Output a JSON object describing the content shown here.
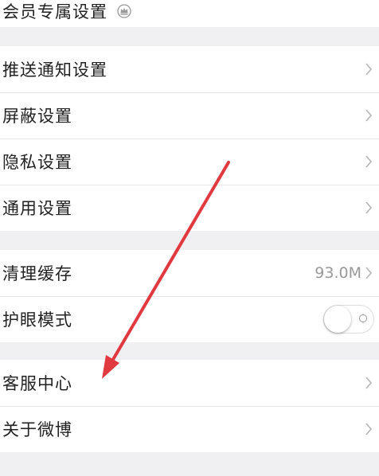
{
  "settings": {
    "vip": {
      "label": "会员专属设置",
      "icon": "crown-icon"
    },
    "push": {
      "label": "推送通知设置"
    },
    "block": {
      "label": "屏蔽设置"
    },
    "privacy": {
      "label": "隐私设置"
    },
    "general": {
      "label": "通用设置"
    },
    "cache": {
      "label": "清理缓存",
      "value": "93.0M"
    },
    "eye": {
      "label": "护眼模式",
      "toggle_on": false
    },
    "service": {
      "label": "客服中心"
    },
    "about": {
      "label": "关于微博"
    }
  },
  "annotation": {
    "color": "#e0393f",
    "icon": "red-arrow"
  }
}
